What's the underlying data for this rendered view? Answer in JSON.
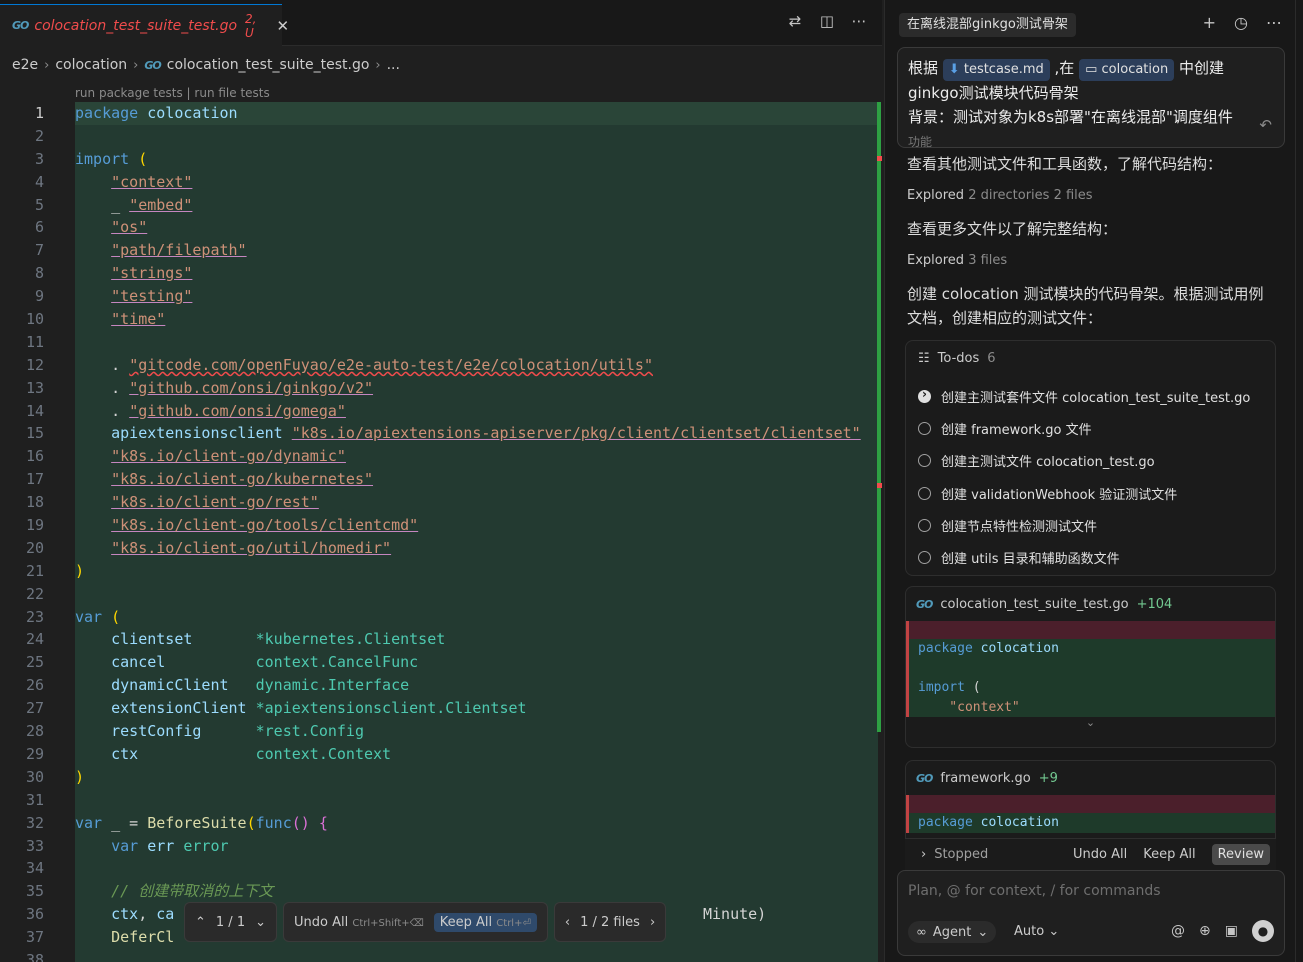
{
  "editor": {
    "tab": {
      "go_icon": "go-file-icon",
      "title": "colocation_test_suite_test.go",
      "badge": "2, U"
    },
    "tab_actions": [
      "compare-changes-icon",
      "split-editor-icon",
      "more-actions-icon"
    ],
    "breadcrumb": [
      "e2e",
      "colocation",
      "colocation_test_suite_test.go",
      "..."
    ],
    "codelens": "run package tests | run file tests",
    "line_numbers": [
      "1",
      "2",
      "3",
      "4",
      "5",
      "6",
      "7",
      "8",
      "9",
      "10",
      "11",
      "12",
      "13",
      "14",
      "15",
      "16",
      "17",
      "18",
      "19",
      "20",
      "21",
      "22",
      "23",
      "24",
      "25",
      "26",
      "27",
      "28",
      "29",
      "30",
      "31",
      "32",
      "33",
      "34",
      "35",
      "36",
      "37",
      "38"
    ],
    "code": [
      [
        [
          "kw",
          "package"
        ],
        [
          "pl",
          " "
        ],
        [
          "id",
          "colocation"
        ]
      ],
      [],
      [
        [
          "kw",
          "import"
        ],
        [
          "pl",
          " "
        ],
        [
          "br",
          "("
        ]
      ],
      [
        [
          "pl",
          "    "
        ],
        [
          "st",
          "\"context\""
        ]
      ],
      [
        [
          "pl",
          "    _ "
        ],
        [
          "st",
          "\"embed\""
        ]
      ],
      [
        [
          "pl",
          "    "
        ],
        [
          "st",
          "\"os\""
        ]
      ],
      [
        [
          "pl",
          "    "
        ],
        [
          "st",
          "\"path/filepath\""
        ]
      ],
      [
        [
          "pl",
          "    "
        ],
        [
          "st",
          "\"strings\""
        ]
      ],
      [
        [
          "pl",
          "    "
        ],
        [
          "st",
          "\"testing\""
        ]
      ],
      [
        [
          "pl",
          "    "
        ],
        [
          "st",
          "\"time\""
        ]
      ],
      [],
      [
        [
          "pl",
          "    . "
        ],
        [
          "st",
          "\"gitcode.com/openFuyao/e2e-auto-test/e2e/colocation/utils\""
        ]
      ],
      [
        [
          "pl",
          "    . "
        ],
        [
          "st",
          "\"github.com/onsi/ginkgo/v2\""
        ]
      ],
      [
        [
          "pl",
          "    . "
        ],
        [
          "st",
          "\"github.com/onsi/gomega\""
        ]
      ],
      [
        [
          "pl",
          "    "
        ],
        [
          "id",
          "apiextensionsclient"
        ],
        [
          "pl",
          " "
        ],
        [
          "st",
          "\"k8s.io/apiextensions-apiserver/pkg/client/clientset/clientset\""
        ]
      ],
      [
        [
          "pl",
          "    "
        ],
        [
          "st",
          "\"k8s.io/client-go/dynamic\""
        ]
      ],
      [
        [
          "pl",
          "    "
        ],
        [
          "st",
          "\"k8s.io/client-go/kubernetes\""
        ]
      ],
      [
        [
          "pl",
          "    "
        ],
        [
          "st",
          "\"k8s.io/client-go/rest\""
        ]
      ],
      [
        [
          "pl",
          "    "
        ],
        [
          "st",
          "\"k8s.io/client-go/tools/clientcmd\""
        ]
      ],
      [
        [
          "pl",
          "    "
        ],
        [
          "st",
          "\"k8s.io/client-go/util/homedir\""
        ]
      ],
      [
        [
          "br",
          ")"
        ]
      ],
      [],
      [
        [
          "kw",
          "var"
        ],
        [
          "pl",
          " "
        ],
        [
          "br",
          "("
        ]
      ],
      [
        [
          "pl",
          "    "
        ],
        [
          "id",
          "clientset"
        ],
        [
          "pl",
          "       "
        ],
        [
          "ty",
          "*kubernetes.Clientset"
        ]
      ],
      [
        [
          "pl",
          "    "
        ],
        [
          "id",
          "cancel"
        ],
        [
          "pl",
          "          "
        ],
        [
          "ty",
          "context.CancelFunc"
        ]
      ],
      [
        [
          "pl",
          "    "
        ],
        [
          "id",
          "dynamicClient"
        ],
        [
          "pl",
          "   "
        ],
        [
          "ty",
          "dynamic.Interface"
        ]
      ],
      [
        [
          "pl",
          "    "
        ],
        [
          "id",
          "extensionClient"
        ],
        [
          "pl",
          " "
        ],
        [
          "ty",
          "*apiextensionsclient.Clientset"
        ]
      ],
      [
        [
          "pl",
          "    "
        ],
        [
          "id",
          "restConfig"
        ],
        [
          "pl",
          "      "
        ],
        [
          "ty",
          "*rest.Config"
        ]
      ],
      [
        [
          "pl",
          "    "
        ],
        [
          "id",
          "ctx"
        ],
        [
          "pl",
          "             "
        ],
        [
          "ty",
          "context.Context"
        ]
      ],
      [
        [
          "br",
          ")"
        ]
      ],
      [],
      [
        [
          "kw",
          "var"
        ],
        [
          "pl",
          " _ = "
        ],
        [
          "fn",
          "BeforeSuite"
        ],
        [
          "br",
          "("
        ],
        [
          "kw",
          "func"
        ],
        [
          "br2",
          "()"
        ],
        [
          "pl",
          " "
        ],
        [
          "br2",
          "{"
        ]
      ],
      [
        [
          "pl",
          "    "
        ],
        [
          "kw",
          "var"
        ],
        [
          "pl",
          " "
        ],
        [
          "id",
          "err"
        ],
        [
          "pl",
          " "
        ],
        [
          "ty",
          "error"
        ]
      ],
      [],
      [
        [
          "pl",
          "    "
        ],
        [
          "cm",
          "// 创建带取消的上下文"
        ]
      ],
      [
        [
          "pl",
          "    "
        ],
        [
          "id",
          "ctx"
        ],
        [
          "pl",
          ", "
        ],
        [
          "id",
          "ca"
        ]
      ],
      [
        [
          "pl",
          "    "
        ],
        [
          "fn",
          "DeferCl"
        ]
      ],
      []
    ],
    "line36_tail": "Minute)",
    "float_bar": {
      "counter": "1 / 1",
      "undo_all": "Undo All",
      "undo_kbd": "Ctrl+Shift+⌫",
      "keep_all": "Keep All",
      "keep_kbd": "Ctrl+⏎",
      "files": "1 / 2 files"
    }
  },
  "panel": {
    "chat_tab": "在离线混部ginkgo测试骨架",
    "header_actions": [
      "new-chat-icon",
      "history-icon",
      "more-icon"
    ],
    "user_message": {
      "prefix": "根据",
      "chip1": "testcase.md",
      "mid": ",在",
      "chip2": "colocation",
      "suffix": "中创建",
      "line2": "ginkgo测试模块代码骨架",
      "line3": "背景：测试对象为k8s部署\"在离线混部\"调度组件",
      "line4": "功能"
    },
    "msg1": "查看其他测试文件和工具函数，了解代码结构：",
    "explored1": {
      "label": "Explored",
      "detail": "2 directories 2 files"
    },
    "msg2": "查看更多文件以了解完整结构：",
    "explored2": {
      "label": "Explored",
      "detail": "3 files"
    },
    "msg3_l1": "创建 colocation 测试模块的代码骨架。根据测试用例",
    "msg3_l2": "文档，创建相应的测试文件：",
    "todos": {
      "title": "To-dos",
      "count": "6",
      "items": [
        "创建主测试套件文件 colocation_test_suite_test.go",
        "创建 framework.go 文件",
        "创建主测试文件 colocation_test.go",
        "创建 validationWebhook 验证测试文件",
        "创建节点特性检测测试文件",
        "创建 utils 目录和辅助函数文件"
      ]
    },
    "diff1": {
      "file": "colocation_test_suite_test.go",
      "plus": "+104",
      "lines": [
        "package colocation",
        "",
        "import (",
        "    \"context\""
      ]
    },
    "diff2": {
      "file": "framework.go",
      "plus": "+9",
      "lines": [
        "package colocation"
      ]
    },
    "stopped": {
      "label": "Stopped",
      "undo_all": "Undo All",
      "keep_all": "Keep All",
      "review": "Review"
    },
    "composer": {
      "placeholder": "Plan, @ for context, / for commands",
      "agent": "Agent",
      "model": "Auto"
    }
  },
  "colors": {
    "accent": "#0078d4",
    "added_bg": "#233a31",
    "modified_file": "#f14c4c"
  }
}
